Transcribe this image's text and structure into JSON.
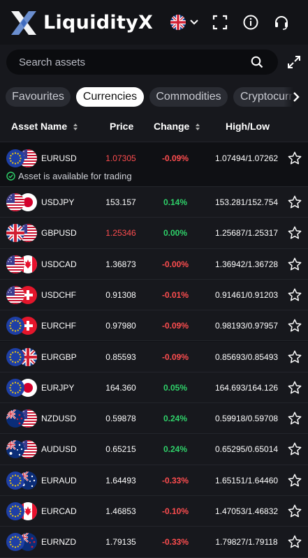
{
  "header": {
    "brand": "LiquidityX",
    "icons": [
      "uk-flag-icon",
      "chevron-down-icon",
      "fullscreen-icon",
      "info-icon",
      "headset-icon"
    ]
  },
  "search": {
    "placeholder": "Search assets"
  },
  "tabs": [
    {
      "label": "Favourites",
      "active": false
    },
    {
      "label": "Currencies",
      "active": true
    },
    {
      "label": "Commodities",
      "active": false
    },
    {
      "label": "Cryptocurrencies",
      "active": false
    }
  ],
  "columns": {
    "asset": "Asset Name",
    "price": "Price",
    "change": "Change",
    "highlow": "High/Low"
  },
  "selected_notice": "Asset is available for trading",
  "colors": {
    "up": "#2fd26a",
    "down": "#ff4d4f",
    "tab_active_bg": "#ffffff"
  },
  "rows": [
    {
      "symbol": "EURUSD",
      "price": "1.07305",
      "price_color": "red",
      "change": "-0.09%",
      "change_color": "red",
      "highlow": "1.07494/1.07262",
      "flags": [
        "eu",
        "us"
      ]
    },
    {
      "symbol": "USDJPY",
      "price": "153.157",
      "price_color": "white",
      "change": "0.14%",
      "change_color": "green",
      "highlow": "153.281/152.754",
      "flags": [
        "us",
        "jp"
      ]
    },
    {
      "symbol": "GBPUSD",
      "price": "1.25346",
      "price_color": "red",
      "change": "0.00%",
      "change_color": "green",
      "highlow": "1.25687/1.25317",
      "flags": [
        "gb",
        "us"
      ]
    },
    {
      "symbol": "USDCAD",
      "price": "1.36873",
      "price_color": "white",
      "change": "-0.00%",
      "change_color": "red",
      "highlow": "1.36942/1.36728",
      "flags": [
        "us",
        "ca"
      ]
    },
    {
      "symbol": "USDCHF",
      "price": "0.91308",
      "price_color": "white",
      "change": "-0.01%",
      "change_color": "red",
      "highlow": "0.91461/0.91203",
      "flags": [
        "us",
        "ch"
      ]
    },
    {
      "symbol": "EURCHF",
      "price": "0.97980",
      "price_color": "white",
      "change": "-0.09%",
      "change_color": "red",
      "highlow": "0.98193/0.97957",
      "flags": [
        "eu",
        "ch"
      ]
    },
    {
      "symbol": "EURGBP",
      "price": "0.85593",
      "price_color": "white",
      "change": "-0.09%",
      "change_color": "red",
      "highlow": "0.85693/0.85493",
      "flags": [
        "eu",
        "gb"
      ]
    },
    {
      "symbol": "EURJPY",
      "price": "164.360",
      "price_color": "white",
      "change": "0.05%",
      "change_color": "green",
      "highlow": "164.693/164.126",
      "flags": [
        "eu",
        "jp"
      ]
    },
    {
      "symbol": "NZDUSD",
      "price": "0.59878",
      "price_color": "white",
      "change": "0.24%",
      "change_color": "green",
      "highlow": "0.59918/0.59708",
      "flags": [
        "nz",
        "us"
      ]
    },
    {
      "symbol": "AUDUSD",
      "price": "0.65215",
      "price_color": "white",
      "change": "0.24%",
      "change_color": "green",
      "highlow": "0.65295/0.65014",
      "flags": [
        "au",
        "us"
      ]
    },
    {
      "symbol": "EURAUD",
      "price": "1.64493",
      "price_color": "white",
      "change": "-0.33%",
      "change_color": "red",
      "highlow": "1.65151/1.64460",
      "flags": [
        "eu",
        "au"
      ]
    },
    {
      "symbol": "EURCAD",
      "price": "1.46853",
      "price_color": "white",
      "change": "-0.10%",
      "change_color": "red",
      "highlow": "1.47053/1.46832",
      "flags": [
        "eu",
        "ca"
      ]
    },
    {
      "symbol": "EURNZD",
      "price": "1.79135",
      "price_color": "white",
      "change": "-0.33%",
      "change_color": "red",
      "highlow": "1.79827/1.79118",
      "flags": [
        "eu",
        "nz"
      ]
    }
  ]
}
